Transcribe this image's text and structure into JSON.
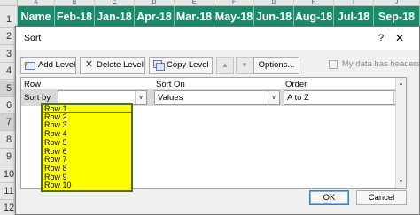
{
  "spreadsheet": {
    "column_letters": [
      "A",
      "B",
      "C",
      "D",
      "E",
      "F",
      "G",
      "H",
      "I",
      "J"
    ],
    "header_row": [
      "Name",
      "Feb-18",
      "Jan-18",
      "Apr-18",
      "Mar-18",
      "May-18",
      "Jun-18",
      "Aug-18",
      "Jul-18",
      "Sep-18"
    ],
    "row_numbers": [
      "1",
      "2",
      "3",
      "4",
      "5",
      "6",
      "7",
      "8",
      "9",
      "10",
      "11",
      "12"
    ],
    "header_color": "#1a8b6a"
  },
  "dialog": {
    "title": "Sort",
    "help_glyph": "?",
    "close_glyph": "✕",
    "toolbar": {
      "add_level": "Add Level",
      "delete_level": "Delete Level",
      "copy_level": "Copy Level",
      "move_up_glyph": "▲",
      "move_down_glyph": "▼",
      "options": "Options...",
      "my_data_has_headers": "My data has headers",
      "my_data_has_headers_checked": false
    },
    "columns": {
      "row": "Row",
      "sort_on": "Sort On",
      "order": "Order"
    },
    "level": {
      "label": "Sort by",
      "row_value": "",
      "sort_on_value": "Values",
      "order_value": "A to Z"
    },
    "row_dropdown_options": [
      "Row 1",
      "Row 2",
      "Row 3",
      "Row 4",
      "Row 5",
      "Row 6",
      "Row 7",
      "Row 8",
      "Row 9",
      "Row 10"
    ],
    "ok": "OK",
    "cancel": "Cancel",
    "highlight_color": "#ffff00"
  }
}
